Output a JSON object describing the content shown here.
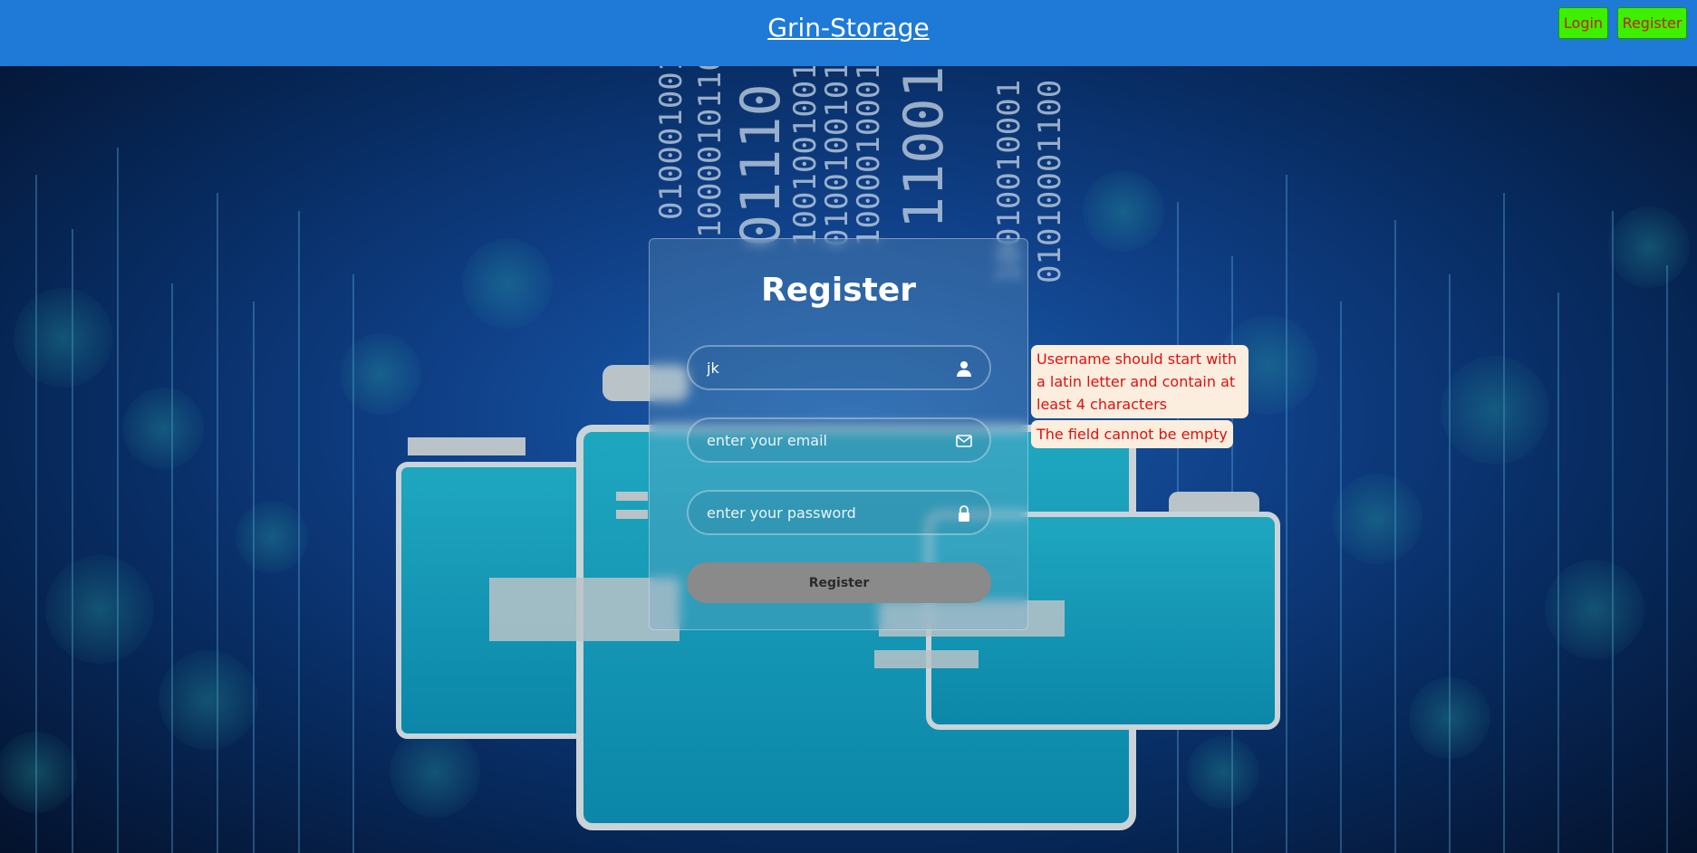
{
  "header": {
    "title": "Grin-Storage",
    "login_label": "Login",
    "register_label": "Register"
  },
  "form": {
    "title": "Register",
    "username_value": "jk",
    "email_placeholder": "enter your email",
    "password_placeholder": "enter your password",
    "submit_label": "Register"
  },
  "errors": {
    "username": "Username should start with a latin letter and contain at least 4 characters",
    "email": "The field cannot be empty"
  },
  "icons": {
    "username": "user-icon",
    "email": "envelope-icon",
    "password": "lock-icon"
  },
  "colors": {
    "header_bg": "#1e7ad6",
    "header_button_bg": "#3cf000",
    "header_button_text": "#c02020",
    "error_bg": "#fbeede",
    "error_text": "#e01010",
    "submit_bg": "#8a8a8a"
  }
}
